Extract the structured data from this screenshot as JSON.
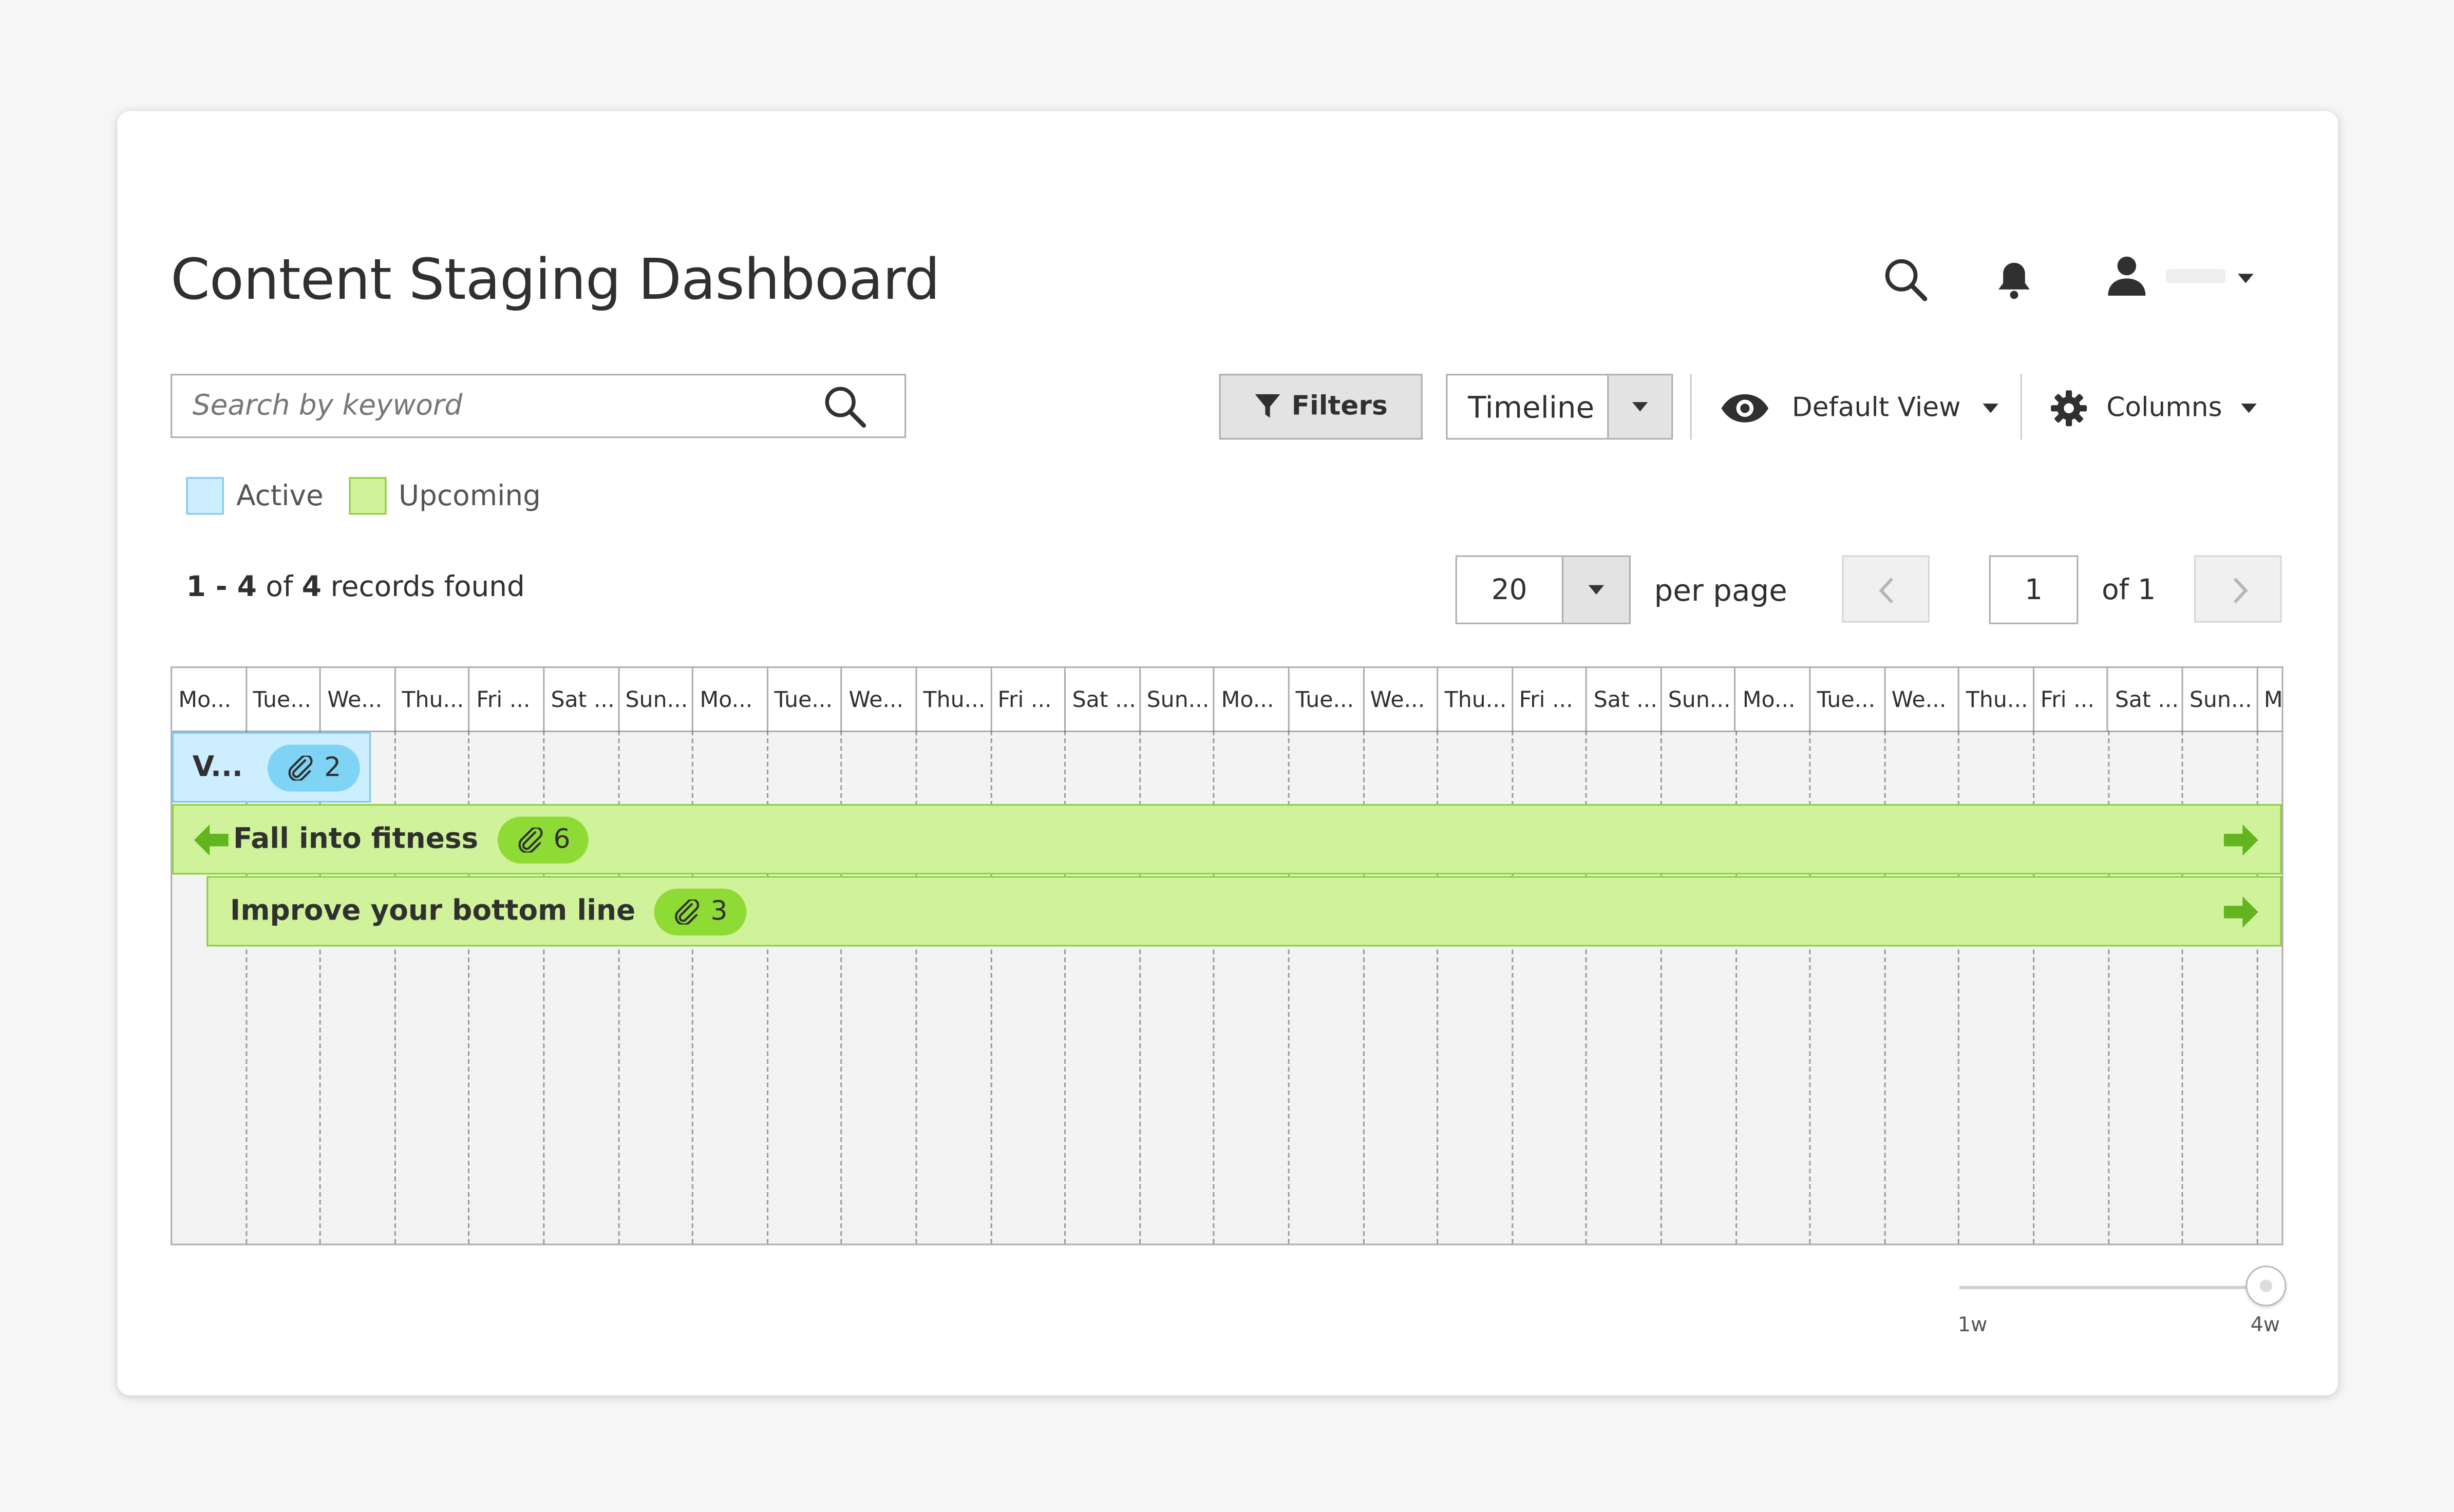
{
  "page": {
    "title": "Content Staging Dashboard"
  },
  "header": {
    "user_caret": "account-menu"
  },
  "toolbar": {
    "search_placeholder": "Search by keyword",
    "filters_label": "Filters",
    "view_mode": "Timeline",
    "default_view_label": "Default View",
    "columns_label": "Columns"
  },
  "legend": [
    {
      "label": "Active",
      "color": "#cceeff"
    },
    {
      "label": "Upcoming",
      "color": "#d0f29b"
    }
  ],
  "records": {
    "from": "1",
    "to": "4",
    "total": "4",
    "suffix": "records found",
    "of": "of"
  },
  "pagination": {
    "per_page": "20",
    "per_page_label": "per page",
    "current_page": "1",
    "of_label": "of 1"
  },
  "timeline": {
    "days": [
      "Mo...",
      "Tue...",
      "We...",
      "Thu...",
      "Fri ...",
      "Sat ...",
      "Sun...",
      "Mo...",
      "Tue...",
      "We...",
      "Thu...",
      "Fri ...",
      "Sat ...",
      "Sun...",
      "Mo...",
      "Tue...",
      "We...",
      "Thu...",
      "Fri ...",
      "Sat ...",
      "Sun...",
      "Mo...",
      "Tue...",
      "We...",
      "Thu...",
      "Fri ...",
      "Sat ...",
      "Sun...",
      "M"
    ],
    "updates": [
      {
        "name": "V...",
        "count": "2",
        "status": "active"
      },
      {
        "name": "Fall into fitness",
        "count": "6",
        "status": "upcoming"
      },
      {
        "name": "Improve your bottom line",
        "count": "3",
        "status": "upcoming"
      }
    ]
  },
  "zoom": {
    "min_label": "1w",
    "max_label": "4w",
    "value": "4w"
  },
  "colors": {
    "active": "#cceeff",
    "upcoming": "#d0f29b",
    "active_pill": "#7fd4f5",
    "upcoming_pill": "#8edb35",
    "arrow": "#62b51f"
  }
}
